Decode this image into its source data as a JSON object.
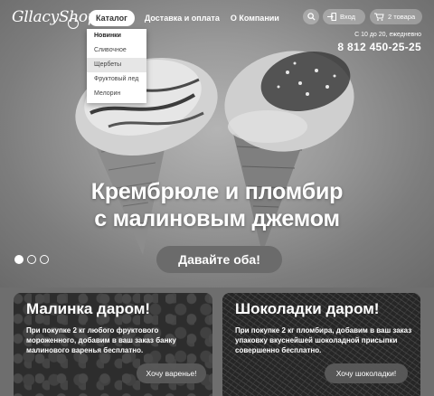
{
  "header": {
    "logo": "GllacyShop",
    "nav": [
      {
        "label": "Каталог",
        "active": true
      },
      {
        "label": "Доставка и оплата",
        "active": false
      },
      {
        "label": "О Компании",
        "active": false
      }
    ],
    "login_label": "Вход",
    "cart_label": "2 товара",
    "hours": "С 10 до 20, ежедневно",
    "phone": "8 812 450-25-25"
  },
  "catalog_menu": [
    {
      "label": "Новинки",
      "bold": true
    },
    {
      "label": "Сливочное"
    },
    {
      "label": "Щербеты",
      "hovered": true
    },
    {
      "label": "Фруктовый лед"
    },
    {
      "label": "Мелорин"
    }
  ],
  "hero": {
    "headline_line1": "Крембрюле и пломбир",
    "headline_line2": "с малиновым джемом",
    "cta_label": "Давайте оба!",
    "slides": 3,
    "active_slide": 1
  },
  "promos": [
    {
      "title": "Малинка даром!",
      "text": "При покупке 2 кг любого фруктового мороженного, добавим в ваш заказ банку малинового варенья бесплатно.",
      "button": "Хочу варенье!"
    },
    {
      "title": "Шоколадки даром!",
      "text": "При покупке 2 кг пломбира, добавим в ваш заказ упаковку вкуснейшей шоколадной присыпки совершенно бесплатно.",
      "button": "Хочу шоколадки!"
    }
  ],
  "colors": {
    "accent_bg": "#6b6b6b",
    "text": "#ffffff"
  },
  "icons": [
    "search-icon",
    "login-icon",
    "cart-icon",
    "logo-icon"
  ]
}
